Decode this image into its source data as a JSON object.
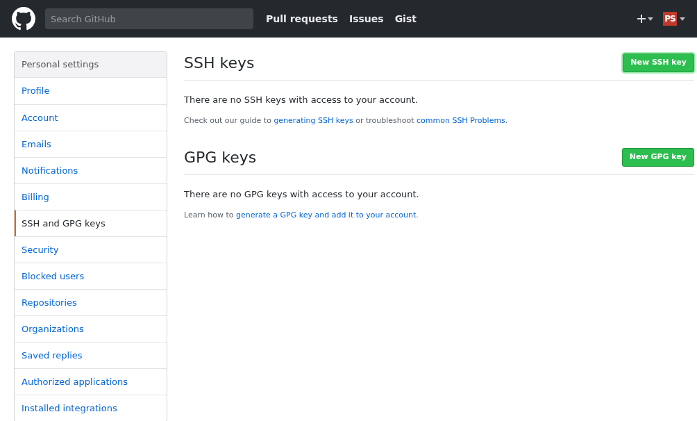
{
  "header": {
    "search": {
      "placeholder": "Search GitHub"
    },
    "nav": [
      "Pull requests",
      "Issues",
      "Gist"
    ],
    "avatar": {
      "initials": "PS"
    }
  },
  "sidebar": {
    "title": "Personal settings",
    "items": [
      {
        "label": "Profile",
        "selected": false
      },
      {
        "label": "Account",
        "selected": false
      },
      {
        "label": "Emails",
        "selected": false
      },
      {
        "label": "Notifications",
        "selected": false
      },
      {
        "label": "Billing",
        "selected": false
      },
      {
        "label": "SSH and GPG keys",
        "selected": true
      },
      {
        "label": "Security",
        "selected": false
      },
      {
        "label": "Blocked users",
        "selected": false
      },
      {
        "label": "Repositories",
        "selected": false
      },
      {
        "label": "Organizations",
        "selected": false
      },
      {
        "label": "Saved replies",
        "selected": false
      },
      {
        "label": "Authorized applications",
        "selected": false
      },
      {
        "label": "Installed integrations",
        "selected": false
      }
    ]
  },
  "sections": [
    {
      "title": "SSH keys",
      "button": {
        "label": "New SSH key",
        "focused": true
      },
      "message": "There are no SSH keys with access to your account.",
      "help": [
        {
          "kind": "text",
          "text": "Check out our guide to "
        },
        {
          "kind": "link",
          "text": "generating SSH keys"
        },
        {
          "kind": "text",
          "text": " or troubleshoot "
        },
        {
          "kind": "link",
          "text": "common SSH Problems"
        },
        {
          "kind": "text",
          "text": "."
        }
      ]
    },
    {
      "title": "GPG keys",
      "button": {
        "label": "New GPG key",
        "focused": false
      },
      "message": "There are no GPG keys with access to your account.",
      "help": [
        {
          "kind": "text",
          "text": "Learn how to "
        },
        {
          "kind": "link",
          "text": "generate a GPG key and add it to your account"
        },
        {
          "kind": "text",
          "text": "."
        }
      ]
    }
  ]
}
